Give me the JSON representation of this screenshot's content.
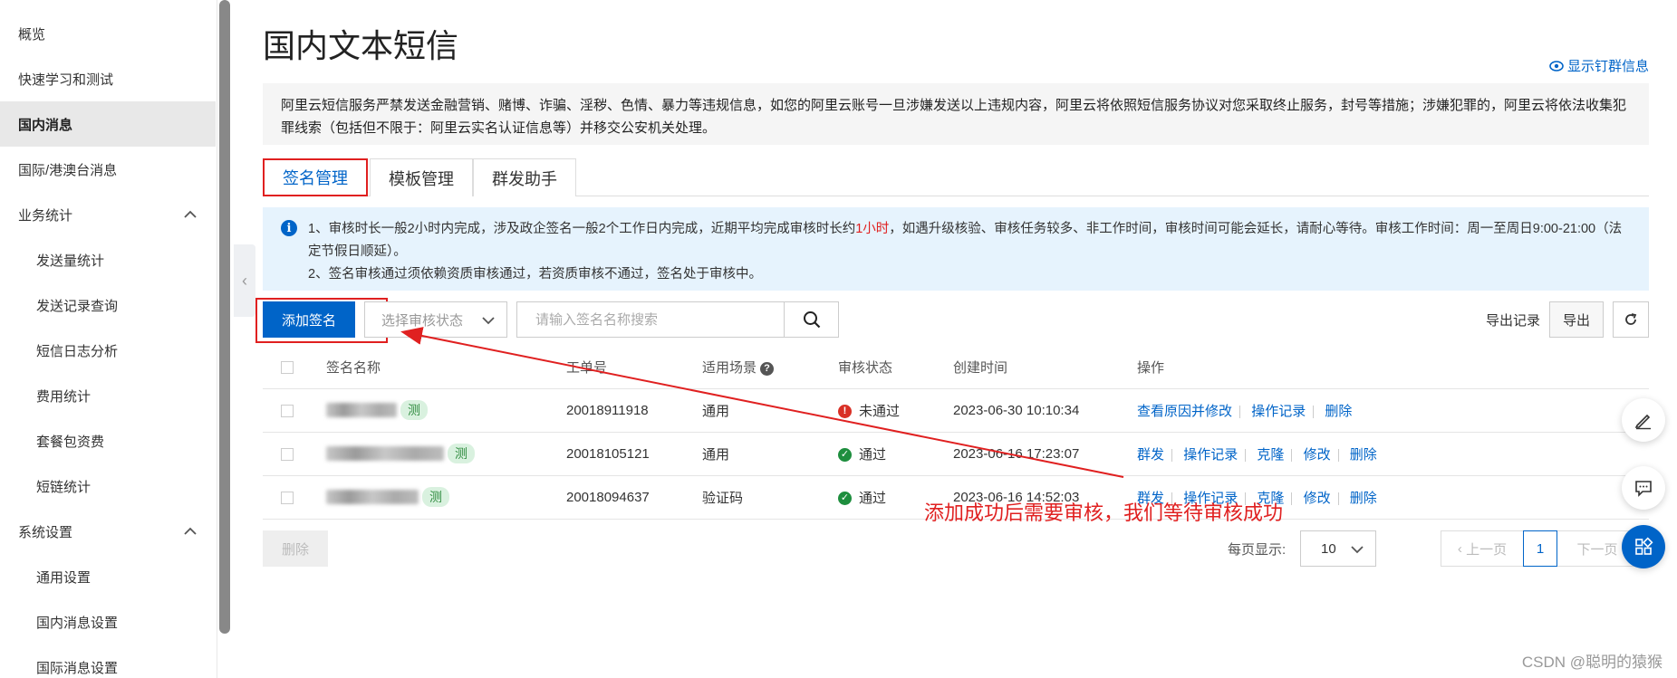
{
  "sidebar": {
    "items": [
      {
        "label": "概览"
      },
      {
        "label": "快速学习和测试"
      },
      {
        "label": "国内消息"
      },
      {
        "label": "国际/港澳台消息"
      },
      {
        "label": "业务统计"
      },
      {
        "label": "发送量统计"
      },
      {
        "label": "发送记录查询"
      },
      {
        "label": "短信日志分析"
      },
      {
        "label": "费用统计"
      },
      {
        "label": "套餐包资费"
      },
      {
        "label": "短链统计"
      },
      {
        "label": "系统设置"
      },
      {
        "label": "通用设置"
      },
      {
        "label": "国内消息设置"
      },
      {
        "label": "国际消息设置"
      }
    ]
  },
  "header": {
    "title": "国内文本短信",
    "show_dingtalk": "显示钉群信息"
  },
  "notice": "阿里云短信服务严禁发送金融营销、赌博、诈骗、淫秽、色情、暴力等违规信息，如您的阿里云账号一旦涉嫌发送以上违规内容，阿里云将依照短信服务协议对您采取终止服务，封号等措施；涉嫌犯罪的，阿里云将依法收集犯罪线索（包括但不限于：阿里云实名认证信息等）并移交公安机关处理。",
  "tabs": [
    {
      "label": "签名管理"
    },
    {
      "label": "模板管理"
    },
    {
      "label": "群发助手"
    }
  ],
  "info": {
    "line1_a": "1、审核时长一般2小时内完成，涉及政企签名一般2个工作日内完成，近期平均完成审核时长约",
    "line1_highlight": "1小时",
    "line1_b": "，如遇升级核验、审核任务较多、非工作时间，审核时间可能会延长，请耐心等待。审核工作时间：周一至周日9:00-21:00（法定节假日顺延）。",
    "line2": "2、签名审核通过须依赖资质审核通过，若资质审核不通过，签名处于审核中。"
  },
  "toolbar": {
    "add_label": "添加签名",
    "status_placeholder": "选择审核状态",
    "search_placeholder": "请输入签名名称搜索",
    "export_record": "导出记录",
    "export": "导出"
  },
  "table": {
    "headers": [
      "签名名称",
      "工单号",
      "适用场景",
      "审核状态",
      "创建时间",
      "操作"
    ],
    "rows": [
      {
        "tag": "测",
        "order": "20018911918",
        "scene": "通用",
        "status": "未通过",
        "status_type": "fail",
        "created": "2023-06-30 10:10:34",
        "ops": [
          "查看原因并修改",
          "操作记录",
          "删除"
        ]
      },
      {
        "tag": "测",
        "order": "20018105121",
        "scene": "通用",
        "status": "通过",
        "status_type": "pass",
        "created": "2023-06-16 17:23:07",
        "ops": [
          "群发",
          "操作记录",
          "克隆",
          "修改",
          "删除"
        ]
      },
      {
        "tag": "测",
        "order": "20018094637",
        "scene": "验证码",
        "status": "通过",
        "status_type": "pass",
        "created": "2023-06-16 14:52:03",
        "ops": [
          "群发",
          "操作记录",
          "克隆",
          "修改",
          "删除"
        ]
      }
    ]
  },
  "bottom": {
    "delete_label": "删除",
    "per_page_label": "每页显示:",
    "per_page_value": "10",
    "prev": "上一页",
    "page": "1",
    "next": "下一页"
  },
  "annotation": "添加成功后需要审核，我们等待审核成功",
  "watermark": "CSDN @聪明的猿猴",
  "colors": {
    "primary": "#0064c8",
    "annotation": "#e02020"
  }
}
